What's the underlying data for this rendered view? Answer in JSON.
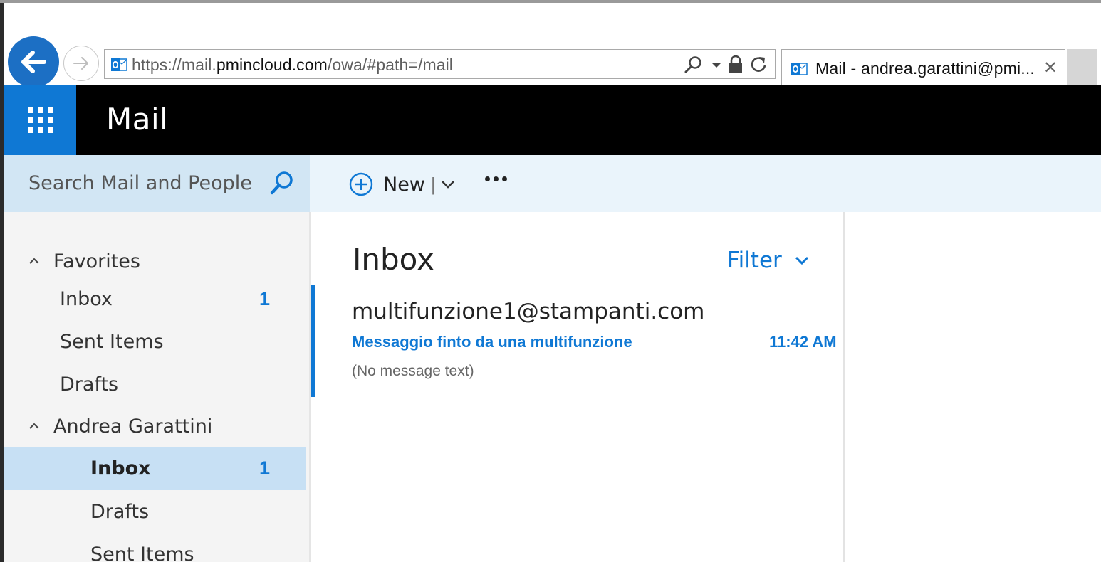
{
  "browser": {
    "url_prefix": "https://mail.",
    "url_domain": "pmincloud.com",
    "url_path": "/owa/#path=/mail",
    "tab_title": "Mail - andrea.garattini@pmi...",
    "tab_close": "✕"
  },
  "app": {
    "title": "Mail"
  },
  "search": {
    "placeholder": "Search Mail and People"
  },
  "toolbar": {
    "new_label": "New",
    "separator": "|"
  },
  "nav": {
    "favorites": {
      "label": "Favorites",
      "items": [
        {
          "label": "Inbox",
          "count": "1"
        },
        {
          "label": "Sent Items",
          "count": ""
        },
        {
          "label": "Drafts",
          "count": ""
        }
      ]
    },
    "account": {
      "label": "Andrea Garattini",
      "items": [
        {
          "label": "Inbox",
          "count": "1"
        },
        {
          "label": "Drafts",
          "count": ""
        },
        {
          "label": "Sent Items",
          "count": ""
        }
      ]
    }
  },
  "list": {
    "folder_title": "Inbox",
    "filter_label": "Filter",
    "messages": [
      {
        "from": "multifunzione1@stampanti.com",
        "subject": "Messaggio finto da una multifunzione",
        "time": "11:42 AM",
        "preview": "(No message text)"
      }
    ]
  },
  "colors": {
    "accent": "#0f78d4",
    "header_bg": "#000000",
    "search_bg": "#d2e6f4",
    "command_bar_bg": "#eaf4fb",
    "nav_bg": "#f4f4f4",
    "selected_bg": "#c7e0f4"
  },
  "icons": {
    "back": "arrow-left-icon",
    "forward": "arrow-right-icon",
    "favicon": "outlook-icon",
    "search": "magnifier-icon",
    "lock": "lock-icon",
    "refresh": "refresh-icon",
    "launcher": "waffle-icon",
    "new": "plus-circle-icon",
    "more": "ellipsis-icon",
    "collapse": "chevron-up-icon",
    "filter": "chevron-down-icon"
  }
}
